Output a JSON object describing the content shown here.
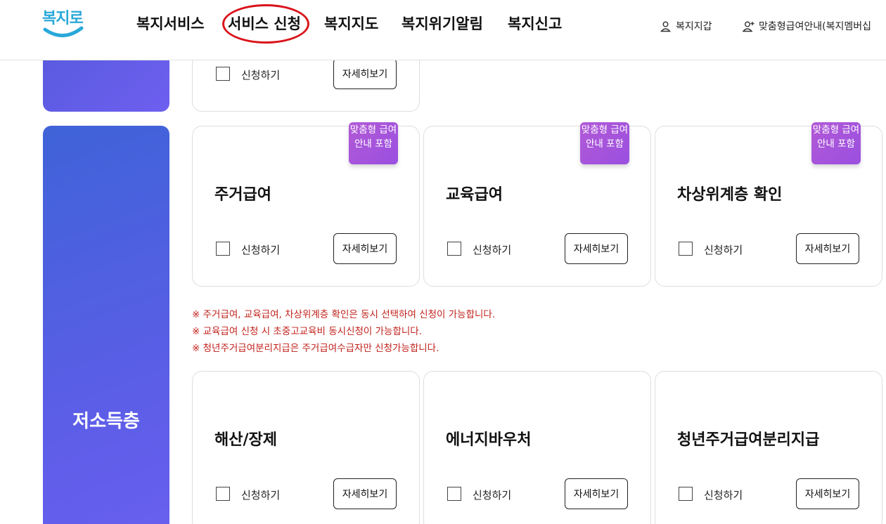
{
  "header": {
    "logo_text": "복지로",
    "nav": [
      "복지서비스",
      "서비스 신청",
      "복지지도",
      "복지위기알림",
      "복지신고"
    ],
    "util": [
      "복지지갑",
      "맞춤형급여안내(복지멤버십"
    ]
  },
  "categories": {
    "main_label": "저소득층"
  },
  "common": {
    "apply_label": "신청하기",
    "detail_label": "자세히보기",
    "badge_text": "맞춤형 급여안내 포함"
  },
  "cards_top": [
    {
      "title": ""
    }
  ],
  "cards_row1": [
    {
      "title": "주거급여",
      "badge": true
    },
    {
      "title": "교육급여",
      "badge": true
    },
    {
      "title": "차상위계층 확인",
      "badge": true
    }
  ],
  "notes": [
    "※ 주거급여, 교육급여, 차상위계층 확인은 동시 선택하여 신청이 가능합니다.",
    "※ 교육급여 신청 시 초중고교육비 동시신청이 가능합니다.",
    "※ 청년주거급여분리지급은 주거급여수급자만 신청가능합니다."
  ],
  "cards_row2": [
    {
      "title": "해산/장제"
    },
    {
      "title": "에너지바우처"
    },
    {
      "title": "청년주거급여분리지급"
    }
  ],
  "colors": {
    "accent_circle": "#d9141b",
    "category_bg": "#4f60e0",
    "badge_bg": "#a653da",
    "note_text": "#c0211b"
  }
}
